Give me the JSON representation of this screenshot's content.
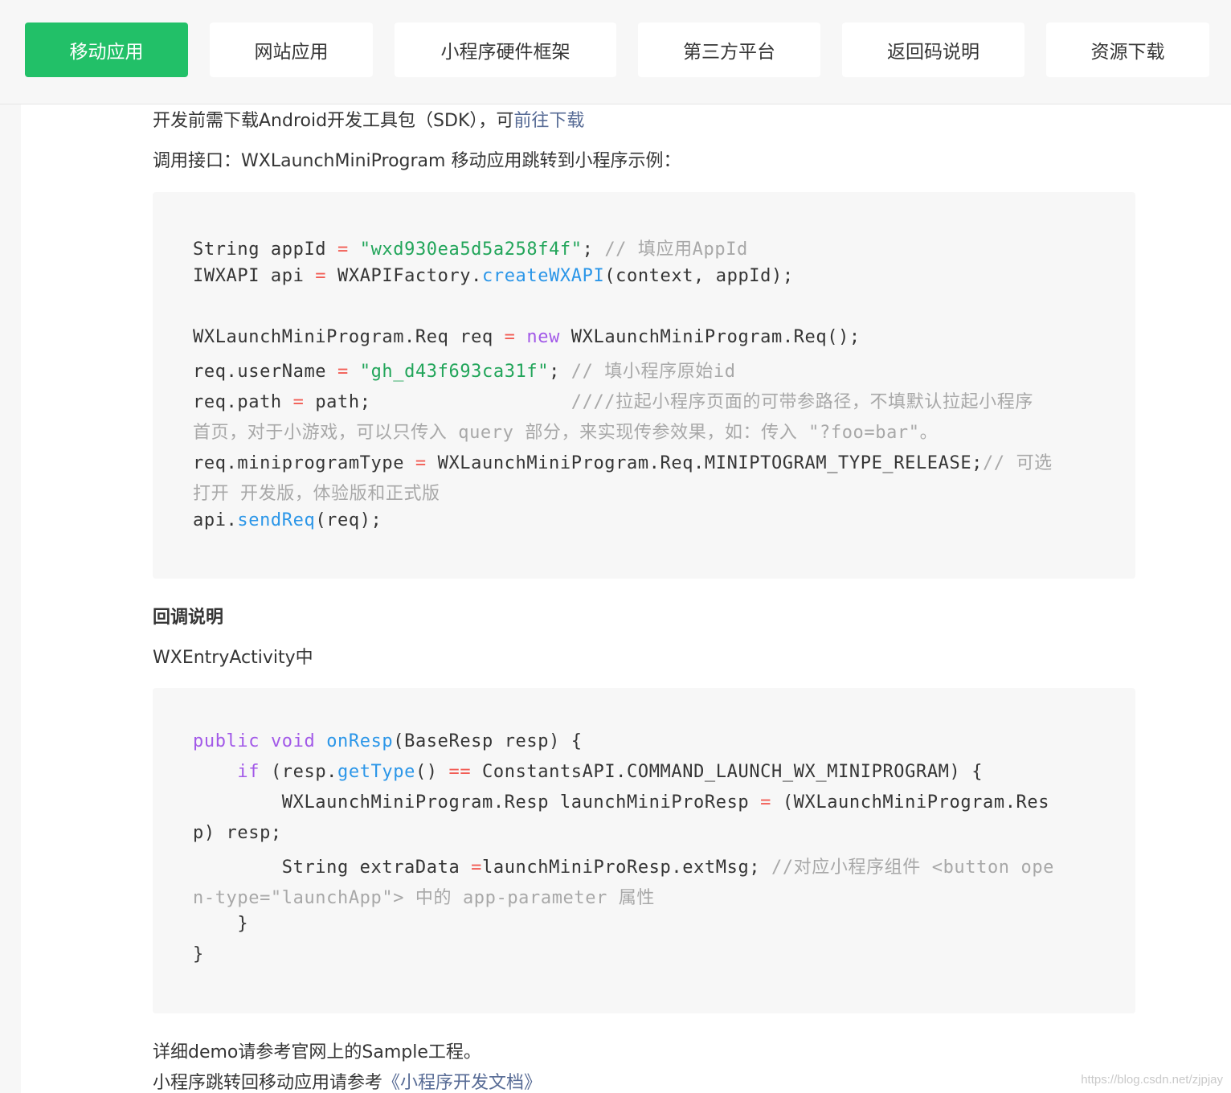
{
  "tabs": [
    {
      "label": "移动应用",
      "active": true
    },
    {
      "label": "网站应用",
      "active": false
    },
    {
      "label": "小程序硬件框架",
      "active": false
    },
    {
      "label": "第三方平台",
      "active": false
    },
    {
      "label": "返回码说明",
      "active": false
    },
    {
      "label": "资源下载",
      "active": false
    }
  ],
  "intro": {
    "sdk_text": "开发前需下载Android开发工具包（SDK），可",
    "sdk_link": "前往下载",
    "api_text": "调用接口：WXLaunchMiniProgram 移动应用跳转到小程序示例："
  },
  "code1": {
    "l1a": "String appId ",
    "l1b": "=",
    "l1c": " ",
    "l1d": "\"wxd930ea5d5a258f4f\"",
    "l1e": "; ",
    "l1f": "// 填应用AppId",
    "l2a": "IWXAPI api ",
    "l2b": "=",
    "l2c": " WXAPIFactory.",
    "l2d": "createWXAPI",
    "l2e": "(context, appId);",
    "l3a": "WXLaunchMiniProgram.Req req ",
    "l3b": "=",
    "l3c": " ",
    "l3d": "new",
    "l3e": " WXLaunchMiniProgram.Req();",
    "l4a": "req.userName ",
    "l4b": "=",
    "l4c": " ",
    "l4d": "\"gh_d43f693ca31f\"",
    "l4e": "; ",
    "l4f": "// 填小程序原始id",
    "l5a": "req.path ",
    "l5b": "=",
    "l5c": " path;                  ",
    "l5d": "////拉起小程序页面的可带参路径，不填默认拉起小程序",
    "l6": "首页，对于小游戏，可以只传入 query 部分，来实现传参效果，如：传入 \"?foo=bar\"。",
    "l7a": "req.miniprogramType ",
    "l7b": "=",
    "l7c": " WXLaunchMiniProgram.Req.MINIPTOGRAM_TYPE_RELEASE;",
    "l7d": "// 可选",
    "l8": "打开 开发版，体验版和正式版",
    "l9a": "api.",
    "l9b": "sendReq",
    "l9c": "(req);"
  },
  "callback": {
    "heading": "回调说明",
    "entry": "WXEntryActivity中"
  },
  "code2": {
    "l1a": "public",
    "l1b": " ",
    "l1c": "void",
    "l1d": " ",
    "l1e": "onResp",
    "l1f": "(BaseResp resp) {",
    "l2a": "    ",
    "l2b": "if",
    "l2c": " (resp.",
    "l2d": "getType",
    "l2e": "() ",
    "l2f": "==",
    "l2g": " ConstantsAPI.COMMAND_LAUNCH_WX_MINIPROGRAM) {",
    "l3a": "        WXLaunchMiniProgram.Resp launchMiniProResp ",
    "l3b": "=",
    "l3c": " (WXLaunchMiniProgram.Res",
    "l4": "p) resp;",
    "l5a": "        String extraData ",
    "l5b": "=",
    "l5c": "launchMiniProResp.extMsg; ",
    "l5d": "//对应小程序组件 <button ope",
    "l6": "n-type=\"launchApp\"> 中的 app-parameter 属性",
    "l7": "    }",
    "l8": "}"
  },
  "footer": {
    "demo_text": "详细demo请参考官网上的Sample工程。",
    "return_text": "小程序跳转回移动应用请参考",
    "return_link": "《小程序开发文档》"
  },
  "watermark": "https://blog.csdn.net/zjpjay",
  "colors": {
    "accent": "#22c068",
    "link": "#576b95",
    "keyword": "#a259e8",
    "string": "#22a55a",
    "function": "#2b96e8",
    "operator": "#f25c54",
    "comment": "#a8a8a8"
  }
}
